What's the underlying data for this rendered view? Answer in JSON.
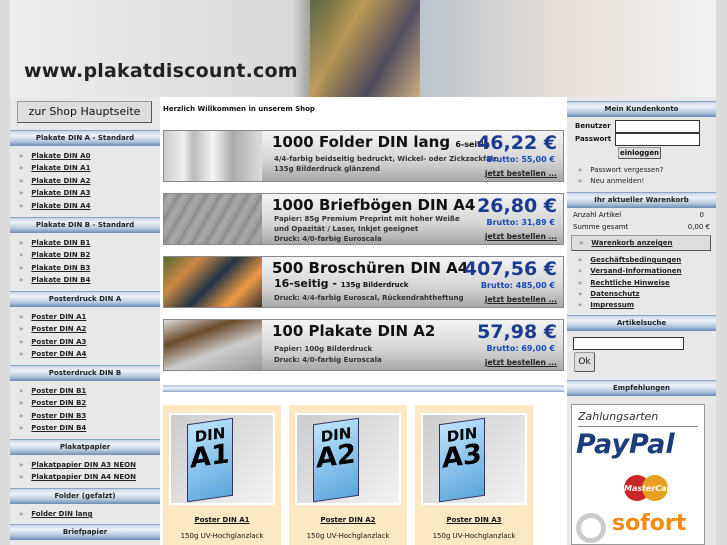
{
  "header": {
    "logo_text": "www.plakatdiscount.com"
  },
  "left": {
    "home_button": "zur Shop Hauptseite",
    "sections": [
      {
        "title": "Plakate DIN A - Standard",
        "items": [
          "Plakate DIN A0",
          "Plakate DIN A1",
          "Plakate DIN A2",
          "Plakate DIN A3",
          "Plakate DIN A4"
        ]
      },
      {
        "title": "Plakate DIN B - Standard",
        "items": [
          "Plakate DIN B1",
          "Plakate DIN B2",
          "Plakate DIN B3",
          "Plakate DIN B4"
        ]
      },
      {
        "title": "Posterdruck DIN A",
        "items": [
          "Poster DIN A1",
          "Poster DIN A2",
          "Poster DIN A3",
          "Poster DIN A4"
        ]
      },
      {
        "title": "Posterdruck DIN B",
        "items": [
          "Poster DIN B1",
          "Poster DIN B2",
          "Poster DIN B3",
          "Poster DIN B4"
        ]
      },
      {
        "title": "Plakatpapier",
        "items": [
          "Plakatpapier DIN A3 NEON",
          "Plakatpapier DIN A4 NEON"
        ]
      },
      {
        "title": "Folder (gefalzt)",
        "items": [
          "Folder DIN lang"
        ]
      },
      {
        "title": "Briefpapier",
        "items": []
      }
    ]
  },
  "center": {
    "welcome": "Herzlich Willkommen in unserem Shop",
    "banners": [
      {
        "title": "1000 Folder DIN lang",
        "suffix": "6-seitig",
        "lines": [
          "4/4-farbig beidseitig bedruckt, Wickel- oder Zickzackfalz",
          "135g Bilderdruck glänzend"
        ],
        "price": "46,22 €",
        "brutto": "Brutto: 55,00 €",
        "order": "jetzt bestellen ..."
      },
      {
        "title": "1000 Briefbögen DIN A4",
        "suffix": "",
        "lines": [
          "Papier: 85g Premium Preprint mit hoher Weiße",
          "und Opazität / Laser, Inkjet geeignet",
          "Druck: 4/0-farbig Euroscala"
        ],
        "price": "26,80 €",
        "brutto": "Brutto: 31,89 €",
        "order": "jetzt bestellen ..."
      },
      {
        "title": "500 Broschüren DIN A4",
        "subtitle": "16-seitig -",
        "subtitle_small": "135g Bilderdruck",
        "lines": [
          "Druck: 4/4-farbig Euroscal, Rückendrahtheftung"
        ],
        "price": "407,56 €",
        "brutto": "Brutto: 485,00 €",
        "order": "jetzt bestellen ..."
      },
      {
        "title": "100 Plakate DIN A2",
        "suffix": "",
        "lines": [
          "Papier: 100g Bilderdruck",
          "Druck: 4/0-farbig Euroscala"
        ],
        "price": "57,98 €",
        "brutto": "Brutto: 69,00 €",
        "order": "jetzt bestellen ..."
      }
    ],
    "products": [
      {
        "din": "DIN",
        "size": "A1",
        "title": "Poster DIN A1",
        "desc": "150g UV-Hochglanzlack"
      },
      {
        "din": "DIN",
        "size": "A2",
        "title": "Poster DIN A2",
        "desc": "150g UV-Hochglanzlack"
      },
      {
        "din": "DIN",
        "size": "A3",
        "title": "Poster DIN A3",
        "desc": "150g UV-Hochglanzlack"
      }
    ]
  },
  "right": {
    "account_title": "Mein Kundenkonto",
    "user_label": "Benutzer",
    "user_value": "",
    "pass_label": "Passwort",
    "pass_value": "",
    "login_button": "einloggen",
    "account_links": [
      "Passwort vergessen?",
      "Neu anmelden!"
    ],
    "cart_title": "Ihr aktueller Warenkorb",
    "items_label": "Anzahl Artikel",
    "items_value": "0",
    "sum_label": "Summe gesamt",
    "sum_value": "0,00 €",
    "cart_button": "Warenkorb anzeigen",
    "info_links": [
      "Geschäftsbedingungen",
      "Versand-Informationen",
      "Rechtliche Hinweise",
      "Datenschutz",
      "Impressum"
    ],
    "search_title": "Artikelsuche",
    "search_value": "",
    "search_button": "Ok",
    "recommend_title": "Empfehlungen",
    "payment": {
      "title": "Zahlungsarten",
      "paypal": "PayPal",
      "mastercard": "MasterCard",
      "sofort": "sofort"
    }
  },
  "colors": {
    "price": "#1a3a8e",
    "card_bg": "#fde8c4",
    "header_blue": "#6d8cb5"
  }
}
